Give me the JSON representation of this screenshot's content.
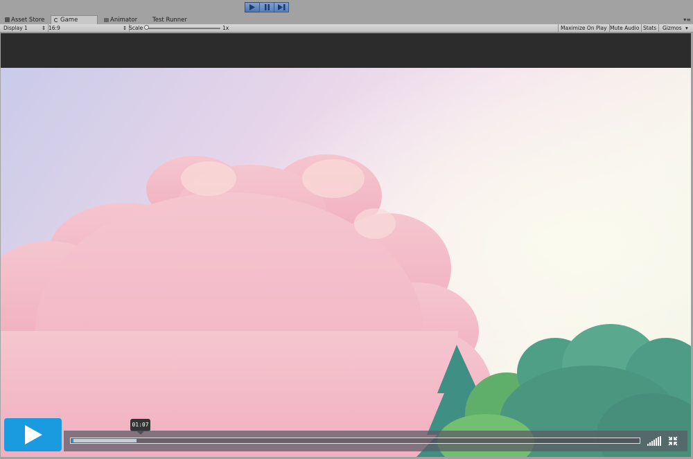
{
  "playmode": {
    "buttons": [
      {
        "name": "play",
        "active": true
      },
      {
        "name": "pause",
        "active": false
      },
      {
        "name": "step",
        "active": false
      }
    ]
  },
  "tabs": [
    {
      "label": "Asset Store",
      "icon": "store-icon"
    },
    {
      "label": "Game",
      "icon": "game-icon",
      "active": true
    },
    {
      "label": "Animator",
      "icon": "animator-icon"
    },
    {
      "label": "Test Runner",
      "icon": ""
    }
  ],
  "game_toolbar": {
    "display": "Display 1",
    "aspect": "16:9",
    "scale_label": "Scale",
    "scale_value": "1x",
    "scale_level": 0.0,
    "maximize_on_play": "Maximize On Play",
    "mute_audio": "Mute Audio",
    "stats": "Stats",
    "gizmos": "Gizmos"
  },
  "video_player": {
    "time_tooltip": "01:07",
    "progress_played": 0.004,
    "progress_loaded": 0.115,
    "colors": {
      "accent": "#1a9be0",
      "bar": "#5a5a64"
    }
  }
}
